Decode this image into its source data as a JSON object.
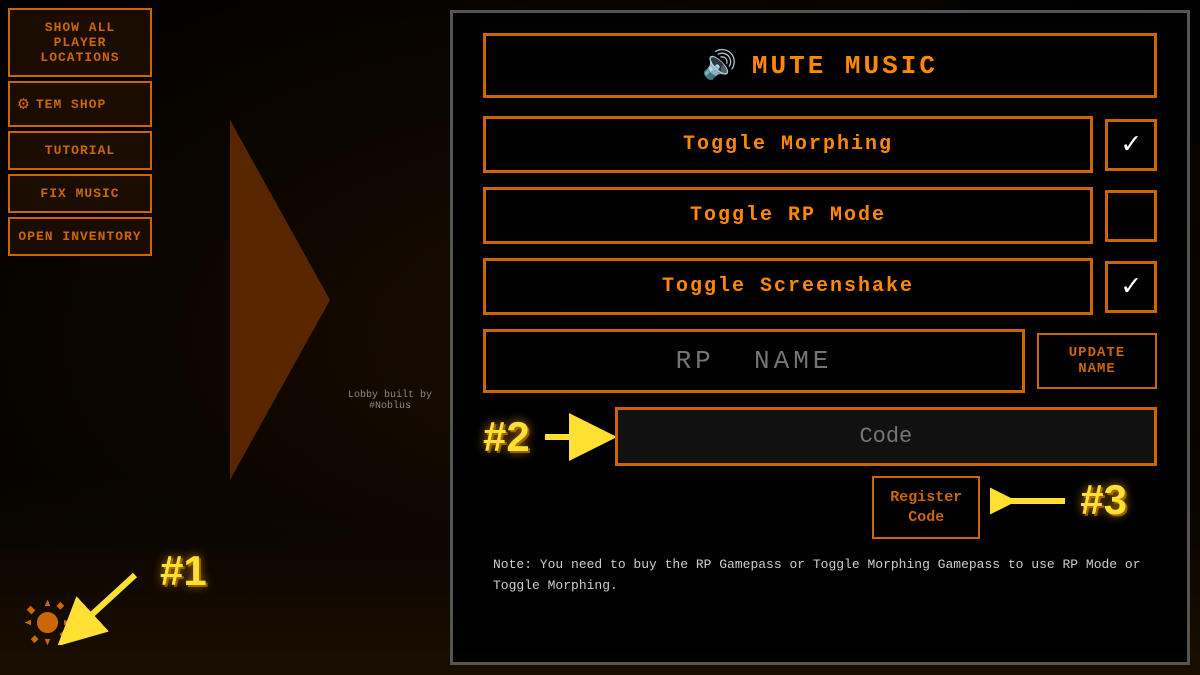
{
  "background": {
    "lobby_text_line1": "Lobby built by",
    "lobby_text_line2": "#Noblus"
  },
  "sidebar": {
    "show_all_label": "Show All Player Locations",
    "tem_shop_label": "TEM SHOP",
    "tutorial_label": "Tutorial",
    "fix_music_label": "Fix Music",
    "open_inventory_label": "OPEN INVENTORY"
  },
  "panel": {
    "mute_music_label": "MUTE MUSIC",
    "toggle_morphing_label": "Toggle Morphing",
    "toggle_morphing_checked": true,
    "toggle_rp_mode_label": "Toggle RP Mode",
    "toggle_rp_mode_checked": false,
    "toggle_screenshake_label": "Toggle Screenshake",
    "toggle_screenshake_checked": true,
    "rp_name_placeholder": "RP  NAME",
    "update_name_label": "UPDATE NAME",
    "code_placeholder": "Code",
    "register_code_label": "Register\nCode",
    "note_text": "Note:  You need to buy the RP Gamepass or Toggle\nMorphing Gamepass to use RP Mode or Toggle Morphing."
  },
  "annotations": {
    "one": "#1",
    "two": "#2",
    "three": "#3"
  },
  "colors": {
    "orange": "#cc6600",
    "orange_bright": "#ff8800",
    "yellow": "#ffe033",
    "dark_bg": "#000000"
  }
}
